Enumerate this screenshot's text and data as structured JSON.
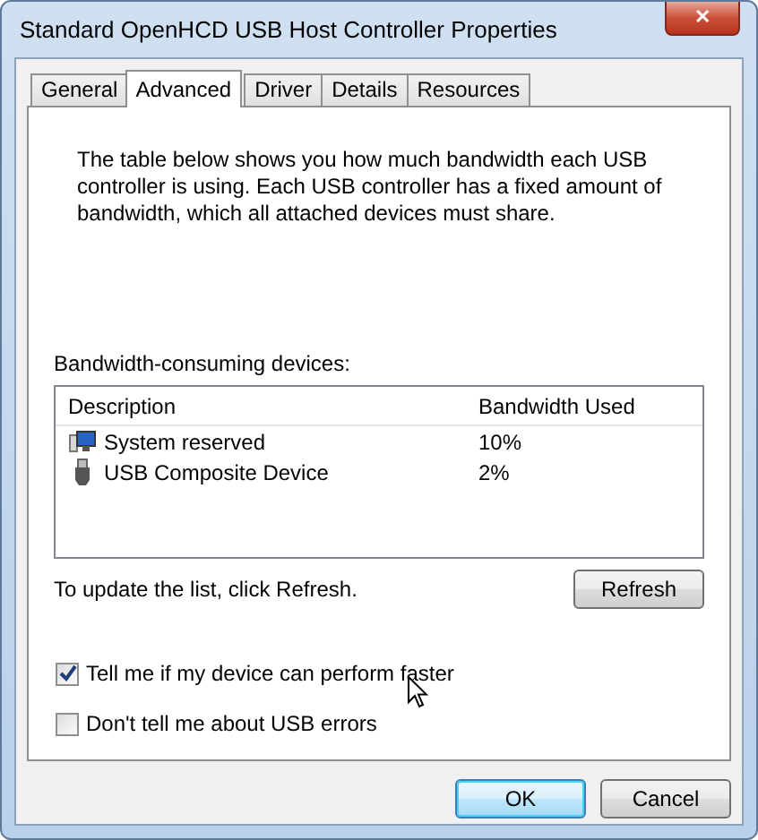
{
  "window": {
    "title": "Standard OpenHCD USB Host Controller Properties",
    "close": "✕"
  },
  "tabs": [
    {
      "label": "General",
      "selected": false
    },
    {
      "label": "Advanced",
      "selected": true
    },
    {
      "label": "Driver",
      "selected": false
    },
    {
      "label": "Details",
      "selected": false
    },
    {
      "label": "Resources",
      "selected": false
    }
  ],
  "intro": "The table below shows you how much bandwidth each USB controller is using. Each USB controller has a fixed amount of bandwidth, which all attached devices must share.",
  "devices_label": "Bandwidth-consuming devices:",
  "table": {
    "columns": [
      "Description",
      "Bandwidth Used"
    ],
    "rows": [
      {
        "kind": "monitor",
        "description": "System reserved",
        "bandwidth": "10%"
      },
      {
        "kind": "usb",
        "description": "USB Composite Device",
        "bandwidth": "2%"
      }
    ]
  },
  "refresh_hint": "To update the list, click Refresh.",
  "refresh_button": "Refresh",
  "options": [
    {
      "label": "Tell me if my device can perform faster",
      "checked": true
    },
    {
      "label": "Don't tell me about USB errors",
      "checked": false
    }
  ],
  "buttons": [
    {
      "label": "OK",
      "kind": "default"
    },
    {
      "label": "Cancel",
      "kind": "normal"
    }
  ]
}
